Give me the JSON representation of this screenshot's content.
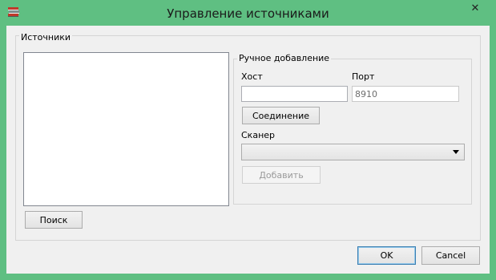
{
  "window": {
    "title": "Управление источниками",
    "close_glyph": "✕",
    "app_icon": "books-icon"
  },
  "sources_group": {
    "label": "Источники",
    "search_button": "Поиск"
  },
  "manual_group": {
    "label": "Ручное добавление",
    "host_label": "Хост",
    "host_value": "",
    "port_label": "Порт",
    "port_value": "8910",
    "connect_button": "Соединение",
    "scanner_label": "Сканер",
    "scanner_value": "",
    "add_button": "Добавить"
  },
  "dialog_buttons": {
    "ok": "OK",
    "cancel": "Cancel"
  },
  "colors": {
    "titlebar": "#5fbf82",
    "client_bg": "#f0f0f0",
    "default_button_border": "#3c7fb1"
  }
}
